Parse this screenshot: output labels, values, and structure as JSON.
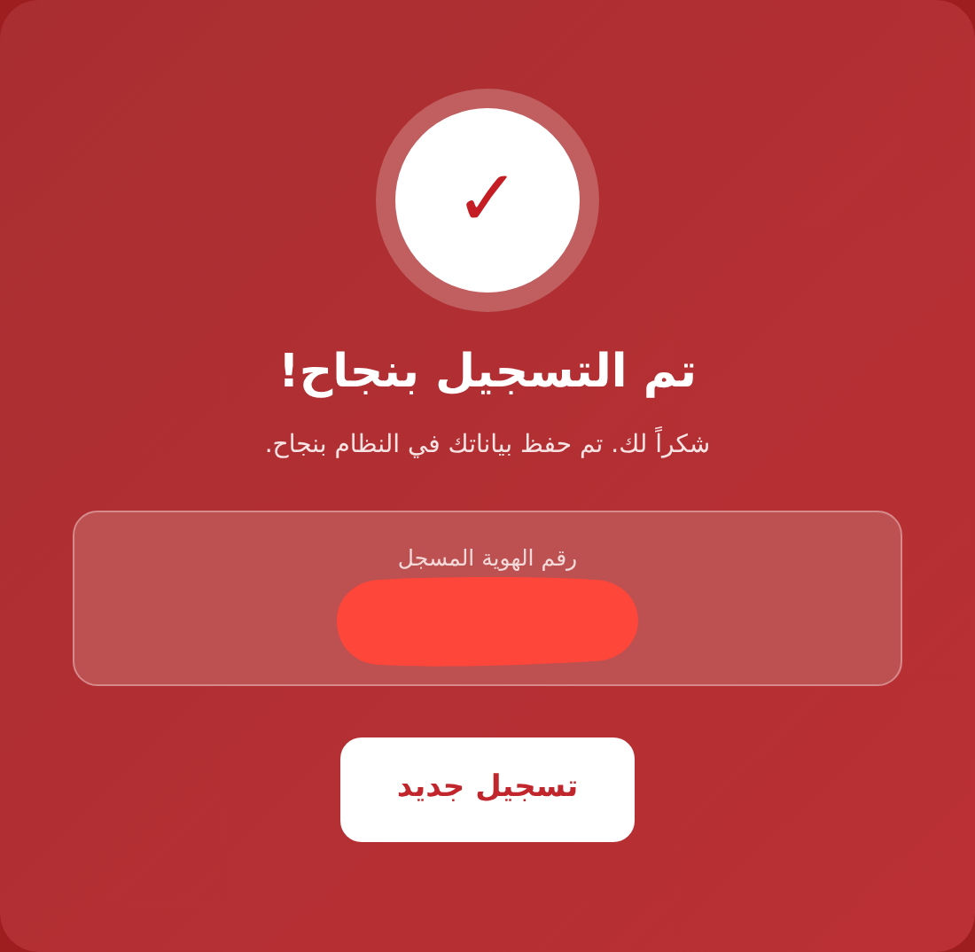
{
  "icon": {
    "glyph": "✓"
  },
  "title": "تم التسجيل بنجاح!",
  "message": "شكراً لك. تم حفظ بياناتك في النظام بنجاح.",
  "id_card": {
    "label": "رقم الهوية المسجل",
    "value_redacted": true
  },
  "button": {
    "label": "تسجيل جديد"
  }
}
